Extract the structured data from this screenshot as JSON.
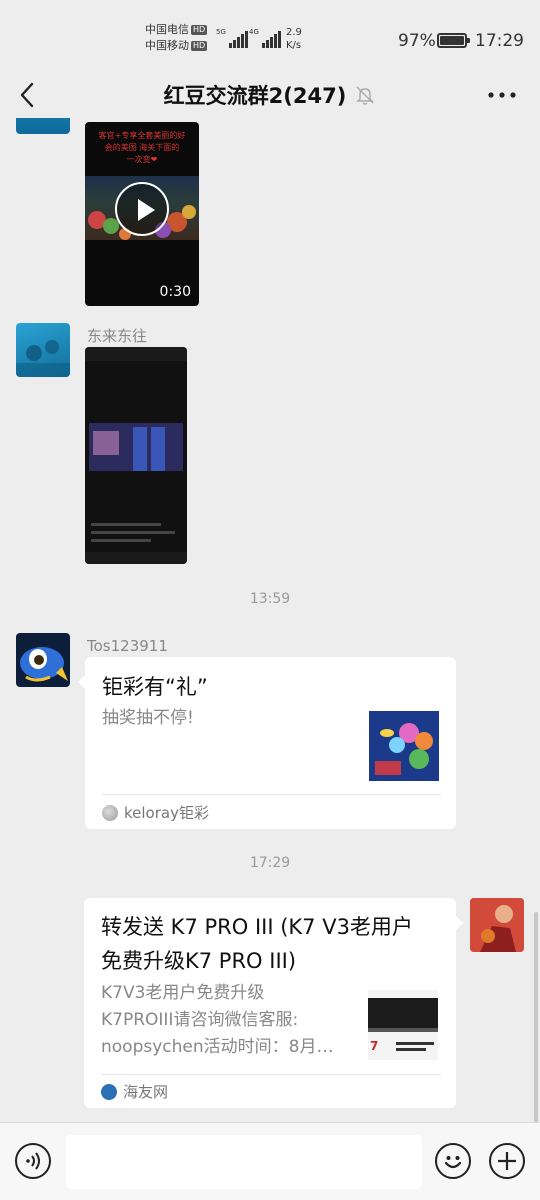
{
  "status_bar": {
    "carrier_1": "中国电信",
    "carrier_2": "中国移动",
    "hd_badge": "HD",
    "net_1": "5G",
    "net_2": "4G",
    "net_speed_value": "2.9",
    "net_speed_unit": "K/s",
    "battery": "97%",
    "time": "17:29"
  },
  "header": {
    "title": "红豆交流群2(247)",
    "back_icon": "chevron-left-icon",
    "mute_icon": "bell-off-icon",
    "more_icon": "more-dots-icon"
  },
  "messages": {
    "video": {
      "caption": "客官+专享全套美丽的好\n会的美图  海关下面的\n一次变❤",
      "duration": "0:30"
    },
    "image_msg": {
      "sender": "东来东往"
    },
    "time_1": "13:59",
    "card_1": {
      "sender": "Tos123911",
      "title": "钜彩有“礼”",
      "desc": "抽奖抽不停!",
      "source": "keloray钜彩"
    },
    "time_2": "17:29",
    "card_2": {
      "title_line_1": "转发送 K7 PRO III (K7 V3老用户",
      "title_line_2": "免费升级K7 PRO III)",
      "desc_line_1": "K7V3老用户免费升级",
      "desc_line_2": "K7PROIII请咨询微信客服:",
      "desc_line_3": "noopsychen活动时间：8月…",
      "source": "海友网"
    }
  },
  "input_bar": {
    "voice_icon": "voice-icon",
    "emoji_icon": "emoji-icon",
    "plus_icon": "plus-icon"
  },
  "colors": {
    "background": "#ededed",
    "bubble": "#ffffff",
    "muted_text": "#888888"
  }
}
